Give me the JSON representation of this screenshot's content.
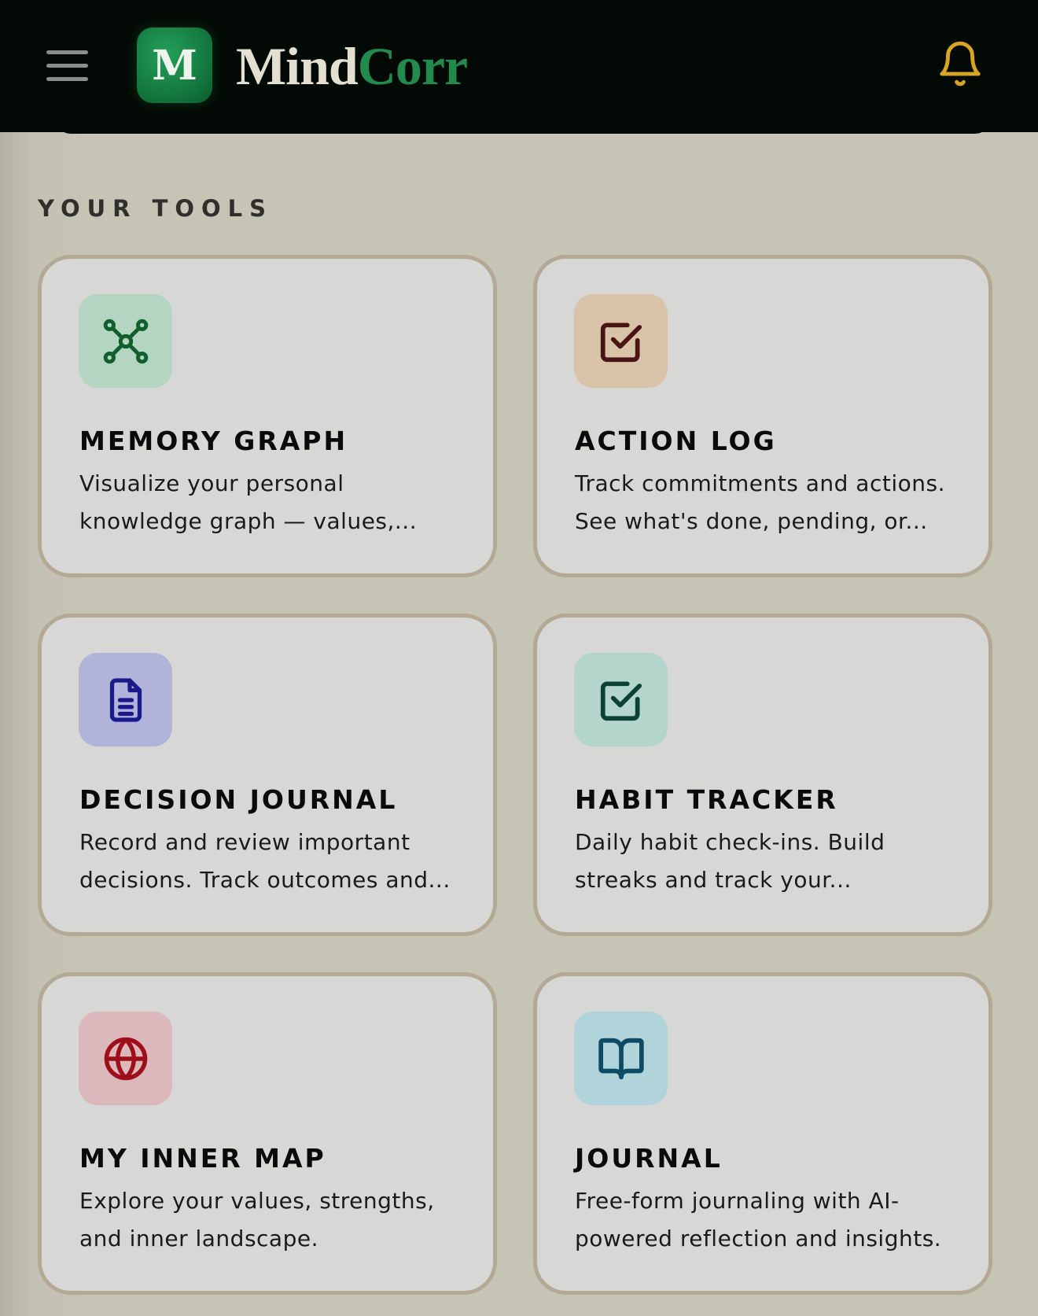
{
  "header": {
    "logo_letter": "M",
    "brand_part1": "Mind",
    "brand_part2": "Corr"
  },
  "section": {
    "title": "YOUR TOOLS"
  },
  "tools": [
    {
      "title": "MEMORY GRAPH",
      "description": "Visualize your personal\nknowledge graph — values,...",
      "icon": "graph-nodes-icon",
      "icon_bg": "#b3d5c2",
      "icon_color": "#115e2e"
    },
    {
      "title": "ACTION LOG",
      "description": "Track commitments and actions.\nSee what's done, pending, or...",
      "icon": "checkbox-icon",
      "icon_bg": "#d8c3a8",
      "icon_color": "#4a1414"
    },
    {
      "title": "DECISION JOURNAL",
      "description": "Record and review important\ndecisions. Track outcomes and...",
      "icon": "document-icon",
      "icon_bg": "#b1b3d8",
      "icon_color": "#1a1a8a"
    },
    {
      "title": "HABIT TRACKER",
      "description": "Daily habit check-ins. Build\nstreaks and track your...",
      "icon": "checkbox-icon",
      "icon_bg": "#b3d5cc",
      "icon_color": "#0c4236"
    },
    {
      "title": "MY INNER MAP",
      "description": "Explore your values, strengths,\nand inner landscape.",
      "icon": "globe-icon",
      "icon_bg": "#dbb8bc",
      "icon_color": "#9e0e1b"
    },
    {
      "title": "JOURNAL",
      "description": "Free-form journaling with AI-\npowered reflection and insights.",
      "icon": "book-icon",
      "icon_bg": "#b0d4da",
      "icon_color": "#0d4a63"
    }
  ],
  "colors": {
    "header_bg": "#030a05",
    "page_bg": "#c6c4b5",
    "card_bg": "#d7d7d6",
    "card_border": "#b3a994",
    "bell": "#d9a323",
    "brand_green": "#238a4d"
  }
}
